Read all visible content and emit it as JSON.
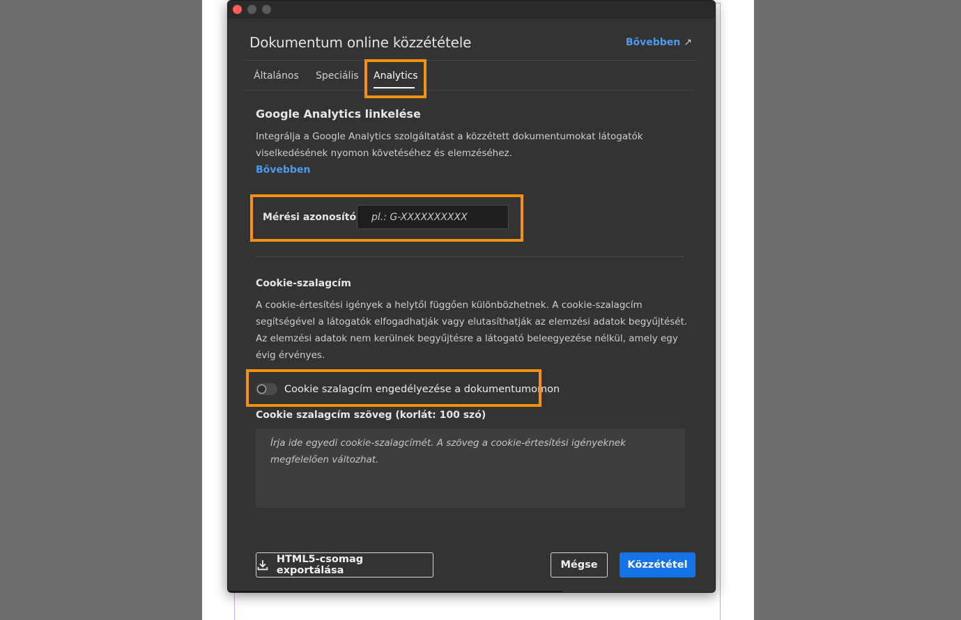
{
  "dialog": {
    "title": "Dokumentum online közzététele",
    "learn_more_label": "Bővebben",
    "learn_more_icon": "external-link-icon"
  },
  "tabs": [
    {
      "label": "Általános"
    },
    {
      "label": "Speciális"
    },
    {
      "label": "Analytics",
      "active": true
    }
  ],
  "analytics": {
    "title": "Google Analytics linkelése",
    "description": "Integrálja a Google Analytics szolgáltatást a közzétett dokumentumokat látogatók viselkedésének nyomon követéséhez és elemzéséhez.",
    "learn_more": "Bővebben",
    "measurement_id_label": "Mérési azonosító",
    "measurement_id_placeholder": "pl.: G-XXXXXXXXXX",
    "measurement_id_value": ""
  },
  "cookie": {
    "title": "Cookie-szalagcím",
    "description": "A cookie-értesítési igények a helytől függően különbözhetnek. A cookie-szalagcím segítségével a látogatók elfogadhatják vagy elutasíthatják az elemzési adatok begyűjtését. Az elemzési adatok nem kerülnek begyűjtésre a látogató beleegyezése nélkül, amely egy évig érvényes.",
    "toggle_label": "Cookie szalagcím engedélyezése a dokumentumomon",
    "toggle_on": false,
    "banner_text_label": "Cookie szalagcím szöveg (korlát: 100 szó)",
    "banner_text_placeholder": "Írja ide egyedi cookie-szalagcímét. A szöveg a cookie-értesítési igényeknek megfelelően változhat.",
    "banner_text_value": ""
  },
  "footer": {
    "export_label": "HTML5-csomag exportálása",
    "export_icon": "download-icon",
    "cancel_label": "Mégse",
    "publish_label": "Közzététel"
  },
  "colors": {
    "accent": "#1473e6",
    "link": "#4c9bf0",
    "highlight": "#f5910f",
    "dialog_bg": "#333333"
  }
}
